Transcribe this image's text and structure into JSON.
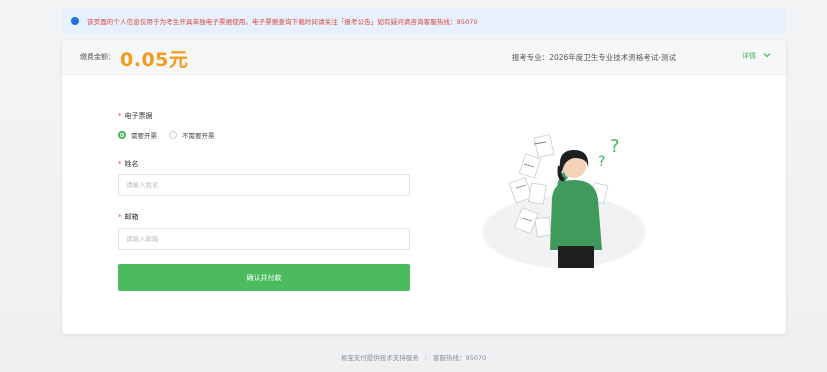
{
  "notice": {
    "text": "该页面的个人信息仅用于为考生开具单独电子票据使用。电子票据查询下载时间请关注「报考公告」如有疑问请咨询客服热线：95070"
  },
  "header": {
    "fee_label": "缴费金额：",
    "fee_amount": "0.05元",
    "major": "报考专业：2026年度卫生专业技术资格考试-测试",
    "detail_link": "详情"
  },
  "form": {
    "invoice_label": "电子票据",
    "invoice_options": [
      "需要开票",
      "不需要开票"
    ],
    "invoice_selected": "需要开票",
    "name_label": "姓名",
    "name_placeholder": "请输入姓名",
    "email_label": "邮箱",
    "email_placeholder": "请输入邮箱",
    "submit_label": "确认并付款"
  },
  "footer": {
    "support": "易宝支付提供技术支持服务",
    "hotline": "客服热线：95070"
  },
  "colors": {
    "accent_green": "#4cbb5f",
    "fee_orange": "#f39b19",
    "notice_red": "#d9453d",
    "notice_bg": "#e6f1fd",
    "info_blue": "#1f6fe0"
  },
  "icons": [
    "info-icon",
    "chevron-down-icon",
    "confused-person-illustration"
  ]
}
